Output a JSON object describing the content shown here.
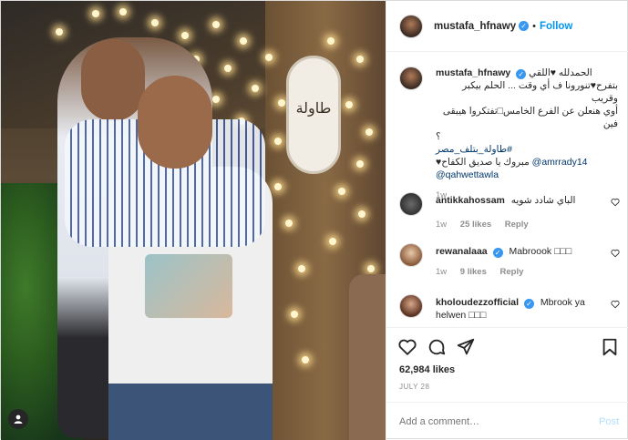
{
  "post": {
    "username": "mustafa_hfnawy",
    "follow_label": "Follow",
    "dot": "•",
    "photo_sign_text": "طاولة"
  },
  "caption": {
    "username": "mustafa_hfnawy",
    "line1": "الحمدلله ♥اللقي",
    "line2": "بتفرح♥تنورونا ف أي وقت ... الحلم بيكبر وقريب",
    "line3": "أوي هنعلن عن الفرع الخامس□تفتكروا هيبقى فين",
    "line4": "؟",
    "hashtag": "#طاولة_بتلف_مصر",
    "line5_text": "♥مبروك يا صديق الكفاح",
    "mention1": "@amrrady14",
    "mention2": "@qahwettawla",
    "time": "1w"
  },
  "comments": [
    {
      "username": "antikkahossam",
      "text": "الباي شادد شويه",
      "time": "1w",
      "likes": "25 likes",
      "reply": "Reply"
    },
    {
      "username": "rewanalaaa",
      "text": "Mabroook □□□",
      "time": "1w",
      "likes": "9 likes",
      "reply": "Reply"
    },
    {
      "username": "kholoudezzofficial",
      "text": "Mbrook ya helwen □□□"
    }
  ],
  "actions": {
    "likes": "62,984 likes",
    "date": "JULY 28"
  },
  "add_comment": {
    "placeholder": "Add a comment…",
    "post_label": "Post"
  },
  "icons": [
    "tag-user-icon",
    "verified-icon",
    "heart-icon",
    "comment-icon",
    "share-icon",
    "bookmark-icon"
  ]
}
